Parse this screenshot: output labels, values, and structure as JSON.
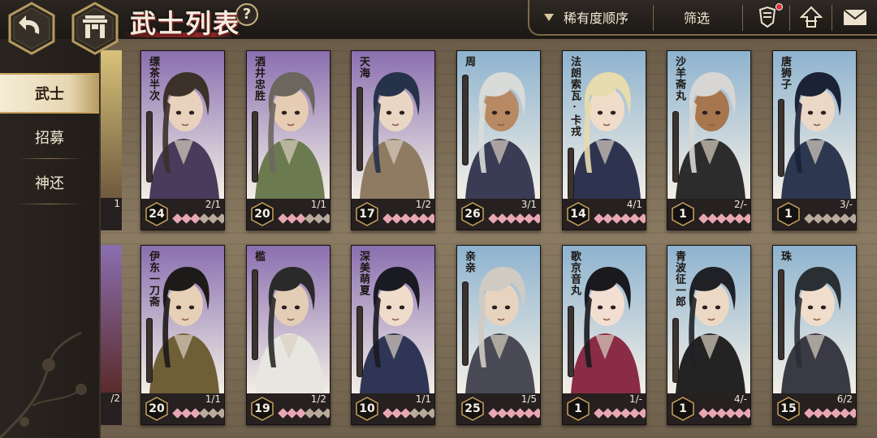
{
  "header": {
    "title": "武士列表",
    "help": "?"
  },
  "topbar": {
    "sort_label": "稀有度顺序",
    "filter_label": "筛选",
    "notification": true
  },
  "sidebar": {
    "items": [
      {
        "label": "武士",
        "active": true
      },
      {
        "label": "招募",
        "active": false
      },
      {
        "label": "神还",
        "active": false
      }
    ]
  },
  "edge_cards": [
    {
      "level": "",
      "frac": "1"
    },
    {
      "level": "",
      "frac": "/2"
    }
  ],
  "cards": [
    {
      "name": "缥茶半次",
      "level": "24",
      "frac": "2/1",
      "bg": "#8a6fb0",
      "hair": "#3b3129",
      "skin": "#e9d2bd",
      "cloth": "#4a3a5c",
      "pips": [
        1,
        1,
        1,
        0,
        0,
        0
      ]
    },
    {
      "name": "酒井忠胜",
      "level": "20",
      "frac": "1/1",
      "bg": "#8a6fb0",
      "hair": "#6b665e",
      "skin": "#e6ccb2",
      "cloth": "#6b7a4f",
      "pips": [
        1,
        1,
        1,
        0,
        0,
        0
      ]
    },
    {
      "name": "天海",
      "level": "17",
      "frac": "1/2",
      "bg": "#8a6fb0",
      "hair": "#26324a",
      "skin": "#ead7c3",
      "cloth": "#8e7b62",
      "pips": [
        1,
        1,
        1,
        1,
        1,
        1
      ]
    },
    {
      "name": "周",
      "level": "26",
      "frac": "3/1",
      "bg": "#8eb3cf",
      "hair": "#d9dbd8",
      "skin": "#b98963",
      "cloth": "#3a3b55",
      "pips": [
        1,
        1,
        1,
        1,
        1,
        1
      ]
    },
    {
      "name": "法朗索瓦·卡戎",
      "level": "14",
      "frac": "4/1",
      "bg": "#8eb3cf",
      "hair": "#e7dcae",
      "skin": "#efdcc9",
      "cloth": "#2e3450",
      "pips": [
        1,
        1,
        1,
        1,
        1,
        1
      ]
    },
    {
      "name": "沙羊斋丸",
      "level": "1",
      "frac": "2/-",
      "bg": "#8eb3cf",
      "hair": "#d7d6d4",
      "skin": "#a7764f",
      "cloth": "#2c2c2c",
      "pips": [
        1,
        1,
        1,
        1,
        1,
        1
      ]
    },
    {
      "name": "唐狮子",
      "level": "1",
      "frac": "3/-",
      "bg": "#8eb3cf",
      "hair": "#1b2236",
      "skin": "#ecd8c6",
      "cloth": "#2d3750",
      "pips": [
        0,
        0,
        0,
        0,
        0,
        0
      ]
    },
    {
      "name": "伊东一刀斋",
      "level": "20",
      "frac": "1/1",
      "bg": "#8a6fb0",
      "hair": "#1d1a1a",
      "skin": "#e6d0b6",
      "cloth": "#6e5f36",
      "pips": [
        1,
        1,
        1,
        0,
        0,
        0
      ]
    },
    {
      "name": "槛",
      "level": "19",
      "frac": "1/2",
      "bg": "#8a6fb0",
      "hair": "#2a2a2a",
      "skin": "#e3cdb5",
      "cloth": "#e8e6e0",
      "pips": [
        1,
        1,
        1,
        0,
        0,
        0
      ]
    },
    {
      "name": "深美萌夏",
      "level": "10",
      "frac": "1/1",
      "bg": "#8a6fb0",
      "hair": "#1a1a22",
      "skin": "#f0dccb",
      "cloth": "#2f3554",
      "pips": [
        1,
        1,
        1,
        0,
        0,
        0
      ]
    },
    {
      "name": "亲亲",
      "level": "25",
      "frac": "1/5",
      "bg": "#8eb3cf",
      "hair": "#cfcbc3",
      "skin": "#e6d3c0",
      "cloth": "#4a4a56",
      "pips": [
        1,
        1,
        1,
        1,
        1,
        1
      ]
    },
    {
      "name": "歌京音丸",
      "level": "1",
      "frac": "1/-",
      "bg": "#8eb3cf",
      "hair": "#1a1a1e",
      "skin": "#f2dfd2",
      "cloth": "#8a2c45",
      "pips": [
        1,
        1,
        1,
        1,
        1,
        1
      ]
    },
    {
      "name": "青波征一郎",
      "level": "1",
      "frac": "4/-",
      "bg": "#8eb3cf",
      "hair": "#1f2127",
      "skin": "#ecd9c5",
      "cloth": "#232323",
      "pips": [
        1,
        1,
        1,
        1,
        1,
        1
      ]
    },
    {
      "name": "珠",
      "level": "15",
      "frac": "6/2",
      "bg": "#8eb3cf",
      "hair": "#2a2f33",
      "skin": "#f0ddcb",
      "cloth": "#3a3a45",
      "pips": [
        1,
        1,
        1,
        1,
        1,
        1
      ]
    }
  ],
  "colors": {
    "pip_on": "#e8a7b2",
    "pip_off": "#b8ab9b",
    "accent": "#c6a35a"
  }
}
